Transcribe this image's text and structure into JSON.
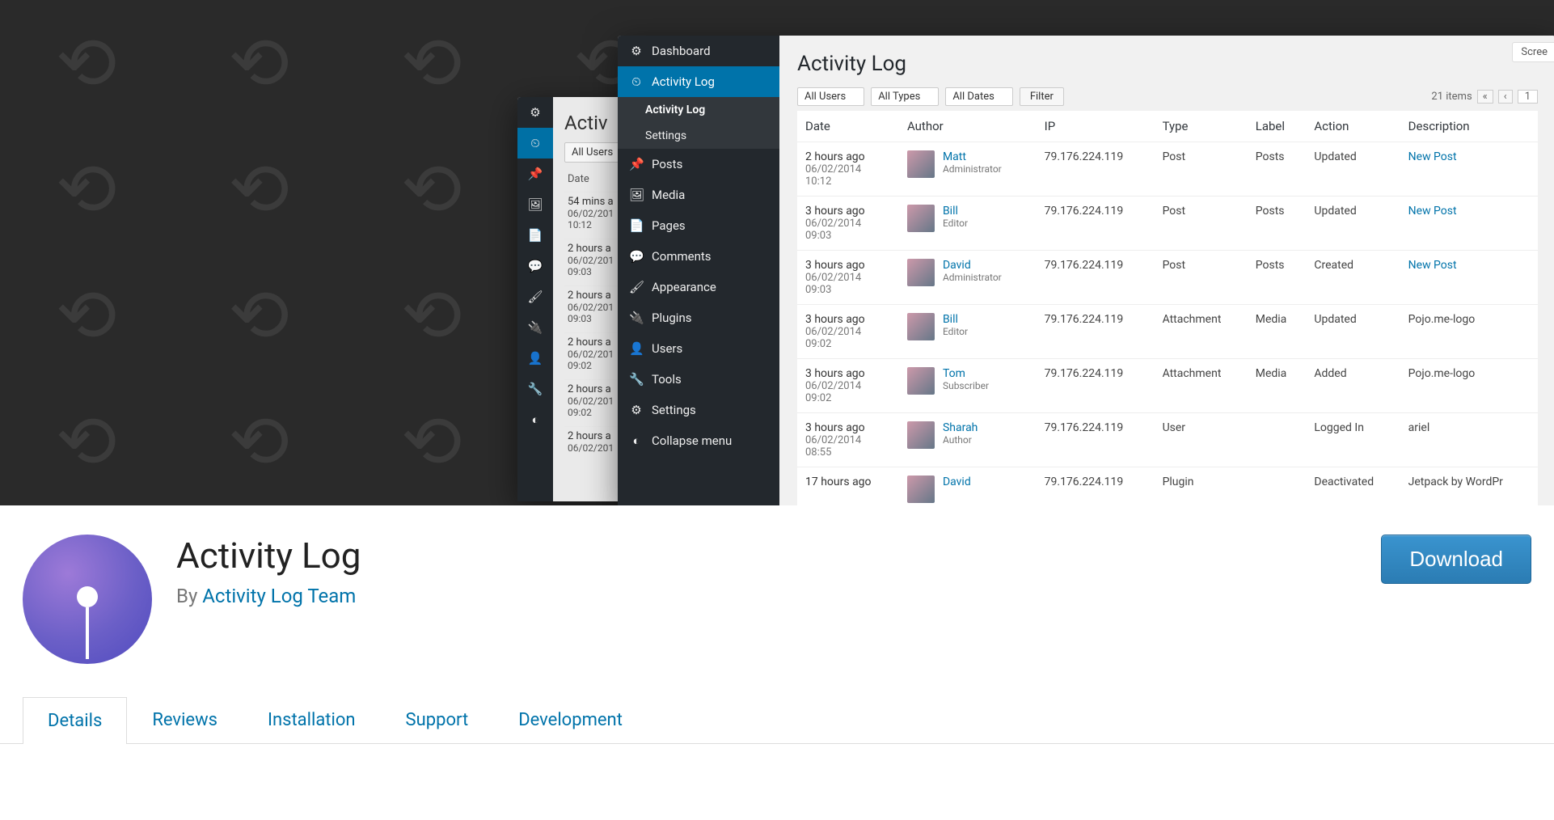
{
  "banner": {
    "mini": {
      "title": "Activ",
      "filter1": "All Users",
      "col_date": "Date",
      "rows": [
        {
          "rel": "54 mins a",
          "abs": "06/02/201",
          "time": "10:12"
        },
        {
          "rel": "2 hours a",
          "abs": "06/02/201",
          "time": "09:03"
        },
        {
          "rel": "2 hours a",
          "abs": "06/02/201",
          "time": "09:03"
        },
        {
          "rel": "2 hours a",
          "abs": "06/02/201",
          "time": "09:02"
        },
        {
          "rel": "2 hours a",
          "abs": "06/02/201",
          "time": "09:02"
        },
        {
          "rel": "2 hours a",
          "abs": "06/02/201",
          "time": ""
        }
      ]
    },
    "side": {
      "items": [
        {
          "icon": "⚙",
          "label": "Dashboard"
        },
        {
          "icon": "⏲",
          "label": "Activity Log",
          "active": true
        },
        {
          "icon": "📌",
          "label": "Posts"
        },
        {
          "icon": "🖼",
          "label": "Media"
        },
        {
          "icon": "📄",
          "label": "Pages"
        },
        {
          "icon": "💬",
          "label": "Comments"
        },
        {
          "icon": "🖌",
          "label": "Appearance"
        },
        {
          "icon": "🔌",
          "label": "Plugins"
        },
        {
          "icon": "👤",
          "label": "Users"
        },
        {
          "icon": "🔧",
          "label": "Tools"
        },
        {
          "icon": "⚙",
          "label": "Settings"
        }
      ],
      "sub": [
        "Activity Log",
        "Settings"
      ],
      "collapse": "Collapse menu"
    },
    "main": {
      "title": "Activity Log",
      "screen": "Scree",
      "filters": {
        "users": "All Users",
        "types": "All Types",
        "dates": "All Dates",
        "filter_btn": "Filter"
      },
      "paging": {
        "count": "21 items",
        "page": "1"
      },
      "cols": [
        "Date",
        "Author",
        "IP",
        "Type",
        "Label",
        "Action",
        "Description"
      ],
      "rows": [
        {
          "rel": "2 hours ago",
          "abs": "06/02/2014",
          "time": "10:12",
          "author": "Matt",
          "role": "Administrator",
          "ip": "79.176.224.119",
          "type": "Post",
          "label": "Posts",
          "action": "Updated",
          "desc": "New Post",
          "link": true
        },
        {
          "rel": "3 hours ago",
          "abs": "06/02/2014",
          "time": "09:03",
          "author": "Bill",
          "role": "Editor",
          "ip": "79.176.224.119",
          "type": "Post",
          "label": "Posts",
          "action": "Updated",
          "desc": "New Post",
          "link": true
        },
        {
          "rel": "3 hours ago",
          "abs": "06/02/2014",
          "time": "09:03",
          "author": "David",
          "role": "Administrator",
          "ip": "79.176.224.119",
          "type": "Post",
          "label": "Posts",
          "action": "Created",
          "desc": "New Post",
          "link": true
        },
        {
          "rel": "3 hours ago",
          "abs": "06/02/2014",
          "time": "09:02",
          "author": "Bill",
          "role": "Editor",
          "ip": "79.176.224.119",
          "type": "Attachment",
          "label": "Media",
          "action": "Updated",
          "desc": "Pojo.me-logo",
          "link": false
        },
        {
          "rel": "3 hours ago",
          "abs": "06/02/2014",
          "time": "09:02",
          "author": "Tom",
          "role": "Subscriber",
          "ip": "79.176.224.119",
          "type": "Attachment",
          "label": "Media",
          "action": "Added",
          "desc": "Pojo.me-logo",
          "link": false
        },
        {
          "rel": "3 hours ago",
          "abs": "06/02/2014",
          "time": "08:55",
          "author": "Sharah",
          "role": "Author",
          "ip": "79.176.224.119",
          "type": "User",
          "label": "",
          "action": "Logged In",
          "desc": "ariel",
          "link": false
        },
        {
          "rel": "17 hours ago",
          "abs": "",
          "time": "",
          "author": "David",
          "role": "",
          "ip": "79.176.224.119",
          "type": "Plugin",
          "label": "",
          "action": "Deactivated",
          "desc": "Jetpack by WordPr",
          "link": false
        }
      ]
    }
  },
  "plugin": {
    "name": "Activity Log",
    "by_prefix": "By ",
    "by_link": "Activity Log Team",
    "download": "Download"
  },
  "tabs": [
    "Details",
    "Reviews",
    "Installation",
    "Support",
    "Development"
  ]
}
